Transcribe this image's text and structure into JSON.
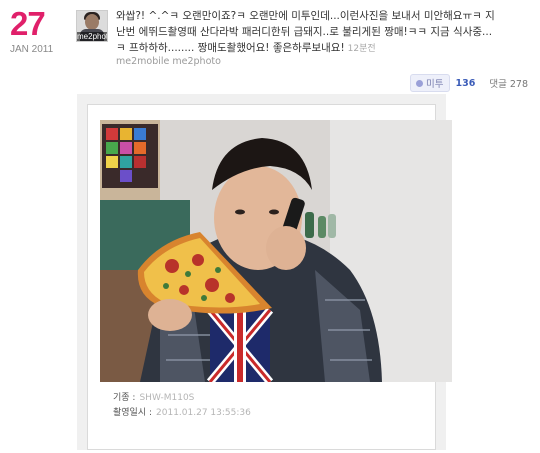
{
  "date": {
    "day": "27",
    "month_year": "JAN 2011"
  },
  "avatar": {
    "label": "me2phot"
  },
  "post": {
    "lines": [
      "와쌉?! ^.^ㅋ 오랜만이죠?ㅋ 오랜만에 미투인데...이런사진을 보내서 미안해요ㅠㅋ 지",
      "난번 에뛰드촬영때 산다라박 패러디한뒤 급돼지..로 불리게된 짱매!ㅋㅋ 지금 식사중...",
      "ㅋ 프하하하........ 짱매도촬했어요! 좋은하루보내요!"
    ],
    "timestamp": "12분전",
    "source": "me2mobile me2photo"
  },
  "actions": {
    "metoo_label": "미투",
    "metoo_count": "136",
    "comment_label": "댓글 278"
  },
  "photo_meta": {
    "device_label": "기종 :",
    "device_value": "SHW-M110S",
    "date_label": "촬영일시 :",
    "date_value": "2011.01.27 13:55:36"
  }
}
